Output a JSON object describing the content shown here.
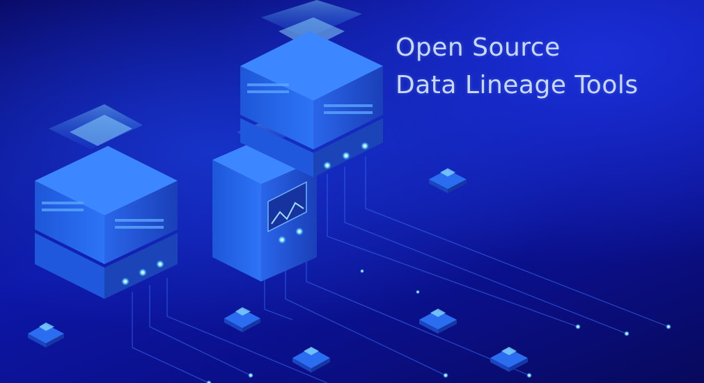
{
  "headline": {
    "line1": "Open Source",
    "line2": "Data Lineage Tools"
  },
  "colors": {
    "background": "#0d17a8",
    "server_face": "#2a6cf5",
    "glow": "#4fd0ff",
    "title_text": "#c9d8ff"
  }
}
